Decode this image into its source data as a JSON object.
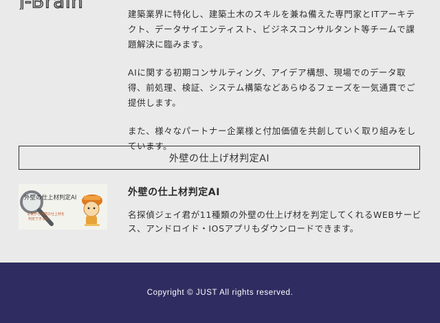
{
  "logo": {
    "text": "J-Brain"
  },
  "intro": {
    "paragraphs": [
      "建築業界に特化し、建築土木のスキルを兼ね備えた専門家とITアーキテクト、データサイエンティスト、ビジネスコンサルタント等チームで課題解決に臨みます。",
      "AIに関する初期コンサルティング、アイデア構想、現場でのデータ取得、前処理、検証、システム構築などあらゆるフェーズを一気通貫でご提供します。",
      "また、様々なパートナー企業様と付加価値を共創していく取り組みをしています。"
    ]
  },
  "cta": {
    "label": "外壁の仕上げ材判定AI"
  },
  "product": {
    "thumb_title": "外壁の仕上材判定AI",
    "thumb_sub1": "写真から外壁の仕上材を",
    "thumb_sub2": "判定できるAI",
    "title": "外壁の仕上材判定AI",
    "description": "名探偵ジェイ君が11種類の外壁の仕上げ材を判定してくれるWEBサービス、アンドロイド・IOSアプリもダウンロードできます。"
  },
  "footer": {
    "copyright": "Copyright © JUST All rights reserved."
  },
  "colors": {
    "footer_bg": "#2f2c61",
    "page_bg": "#eaeaea",
    "accent": "#e07a1f"
  }
}
